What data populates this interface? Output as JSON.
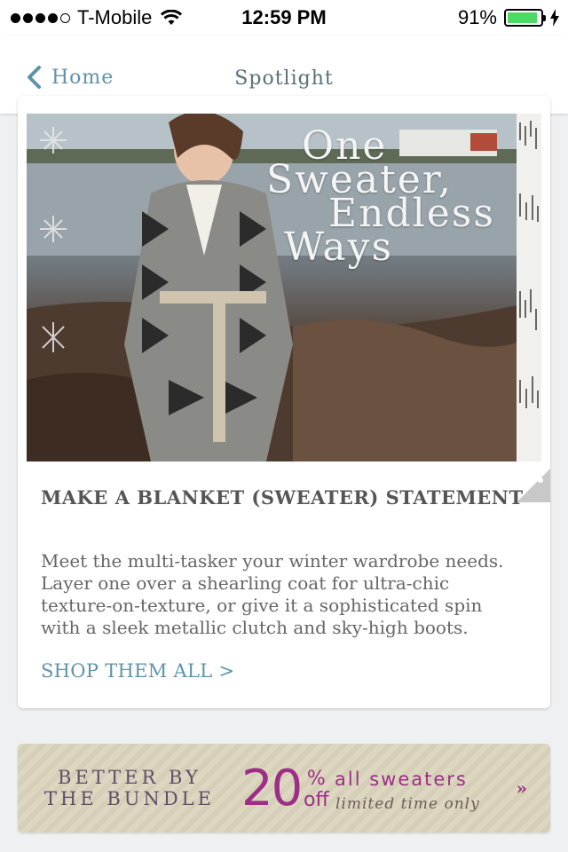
{
  "status_bar": {
    "carrier": "T-Mobile",
    "time": "12:59 PM",
    "battery_percent": "91%",
    "battery_level": 0.91,
    "signal_bars": 4,
    "signal_total": 5,
    "icons": [
      "wifi-icon",
      "battery-icon",
      "charging-icon"
    ]
  },
  "nav": {
    "back_label": "Home",
    "title": "Spotlight",
    "back_icon": "chevron-left-icon",
    "accent_color": "#5f93aa"
  },
  "card": {
    "hero_lines": [
      "One",
      "Sweater,",
      "Endless",
      "Ways"
    ],
    "title": "MAKE A BLANKET (SWEATER) STATEMENT",
    "description": "Meet the multi-tasker your winter wardrobe needs. Layer one over a shearling coat for ultra-chic texture-on-texture, or give it a sophisticated spin with a sleek metallic clutch and sky-high boots.",
    "link": "SHOP THEM ALL >"
  },
  "banner": {
    "left_line1": "BETTER BY",
    "left_line2": "THE BUNDLE",
    "percent": "20",
    "percent_sign": "%",
    "off": "off",
    "offer": "all sweaters",
    "limited": "limited time only",
    "arrow": "»",
    "accent_color": "#9c2f85"
  }
}
